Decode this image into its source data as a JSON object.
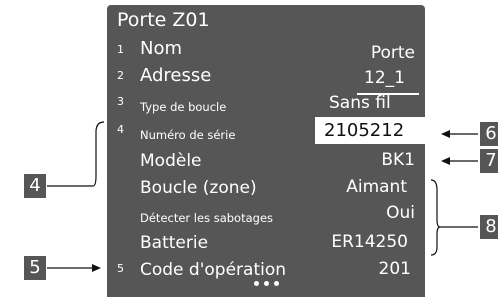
{
  "screen": {
    "title": "Porte Z01",
    "rows": [
      {
        "num": "1",
        "label": "Nom",
        "value": "Porte"
      },
      {
        "num": "2",
        "label": "Adresse",
        "value": "12_1"
      },
      {
        "num": "3",
        "label": "Type de boucle",
        "value": "Sans fil"
      },
      {
        "num": "4",
        "label": "Numéro de série",
        "value": "2105212"
      },
      {
        "num": "",
        "label": "Modèle",
        "value": "BK1"
      },
      {
        "num": "",
        "label": "Boucle (zone)",
        "value": "Aimant"
      },
      {
        "num": "",
        "label": "Détecter les sabotages",
        "value": "Oui"
      },
      {
        "num": "",
        "label": "Batterie",
        "value": "ER14250"
      },
      {
        "num": "5",
        "label": "Code d'opération",
        "value": "201"
      }
    ]
  },
  "callouts": {
    "c4": "4",
    "c5": "5",
    "c6": "6",
    "c7": "7",
    "c8": "8"
  }
}
